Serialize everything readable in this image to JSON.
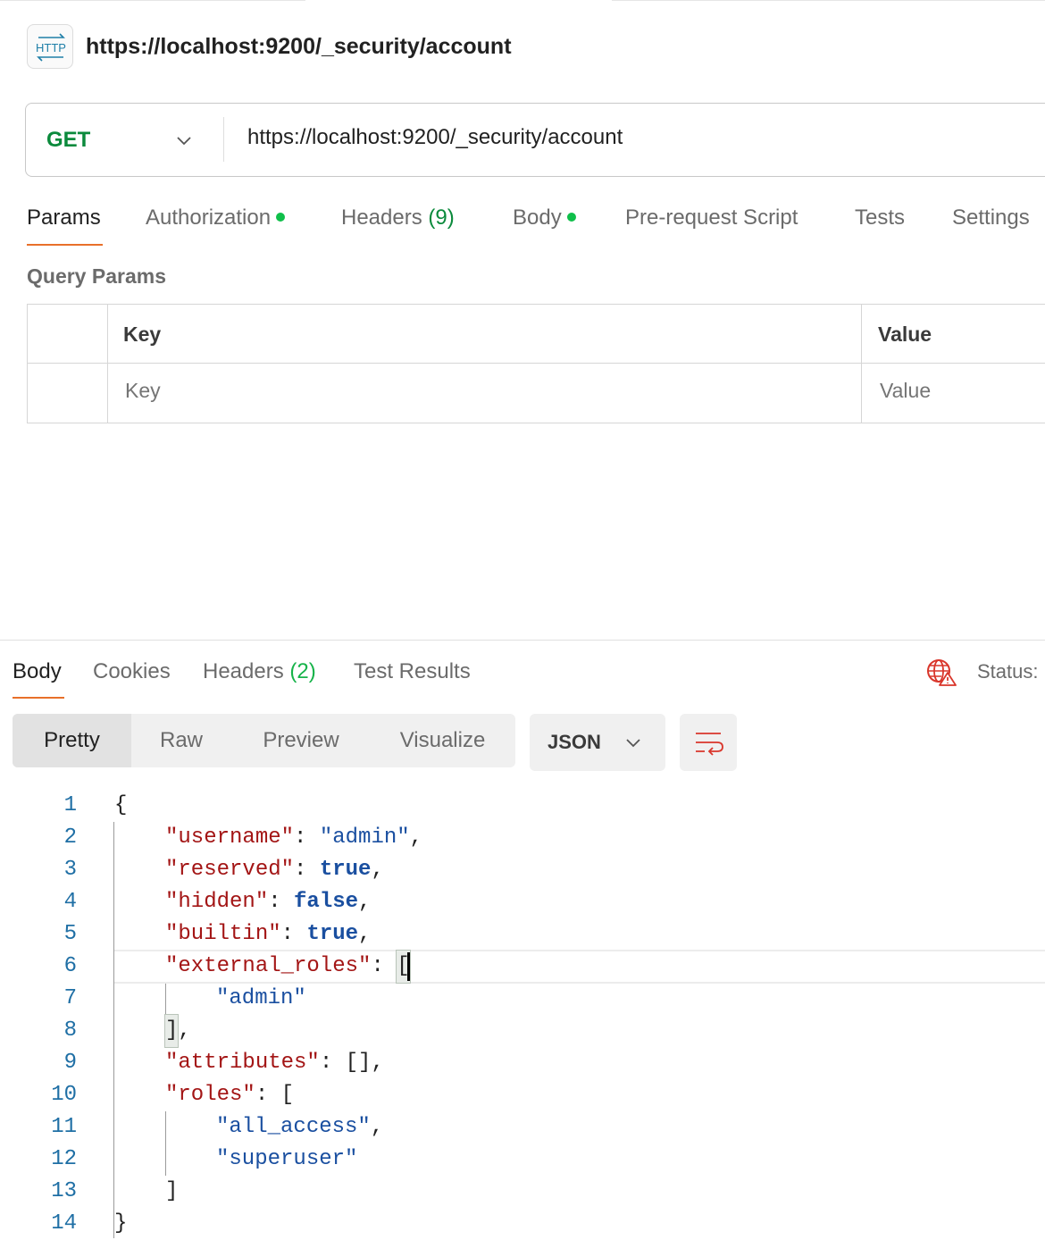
{
  "request": {
    "title": "https://localhost:9200/_security/account",
    "method": "GET",
    "url": "https://localhost:9200/_security/account"
  },
  "request_tabs": {
    "params": "Params",
    "authorization": "Authorization",
    "headers": "Headers",
    "headers_count": "(9)",
    "body": "Body",
    "pre_request": "Pre-request Script",
    "tests": "Tests",
    "settings": "Settings"
  },
  "query_params": {
    "label": "Query Params",
    "columns": [
      "Key",
      "Value"
    ],
    "placeholders": {
      "key": "Key",
      "value": "Value"
    }
  },
  "response_tabs": {
    "body": "Body",
    "cookies": "Cookies",
    "headers": "Headers",
    "headers_count": "(2)",
    "test_results": "Test Results",
    "status_label": "Status:"
  },
  "view_modes": [
    "Pretty",
    "Raw",
    "Preview",
    "Visualize"
  ],
  "format": "JSON",
  "colors": {
    "accent": "#e8702a",
    "method": "#0b8a3c",
    "dot": "#0fbf4a",
    "json_key": "#a31515",
    "json_value": "#1a4fa0",
    "line_number": "#1f6fa5",
    "error_icon": "#d9362b"
  },
  "response_body": {
    "line_numbers": [
      "1",
      "2",
      "3",
      "4",
      "5",
      "6",
      "7",
      "8",
      "9",
      "10",
      "11",
      "12",
      "13",
      "14"
    ],
    "lines": {
      "l1": "{",
      "l2_key": "\"username\"",
      "l2_sep": ": ",
      "l2_val": "\"admin\"",
      "l2_end": ",",
      "l3_key": "\"reserved\"",
      "l3_sep": ": ",
      "l3_val": "true",
      "l3_end": ",",
      "l4_key": "\"hidden\"",
      "l4_sep": ": ",
      "l4_val": "false",
      "l4_end": ",",
      "l5_key": "\"builtin\"",
      "l5_sep": ": ",
      "l5_val": "true",
      "l5_end": ",",
      "l6_key": "\"external_roles\"",
      "l6_sep": ": ",
      "l6_val": "[",
      "l7_val": "\"admin\"",
      "l8_val": "]",
      "l8_end": ",",
      "l9_key": "\"attributes\"",
      "l9_sep": ": ",
      "l9_val": "[]",
      "l9_end": ",",
      "l10_key": "\"roles\"",
      "l10_sep": ": ",
      "l10_val": "[",
      "l11_val": "\"all_access\"",
      "l11_end": ",",
      "l12_val": "\"superuser\"",
      "l13": "]",
      "l14": "}"
    }
  },
  "icons": {
    "request_type": "http-icon",
    "method_dropdown": "chevron-down-icon",
    "network_error": "globe-warning-icon",
    "format_dropdown": "chevron-down-icon",
    "wrap": "wrap-lines-icon"
  }
}
